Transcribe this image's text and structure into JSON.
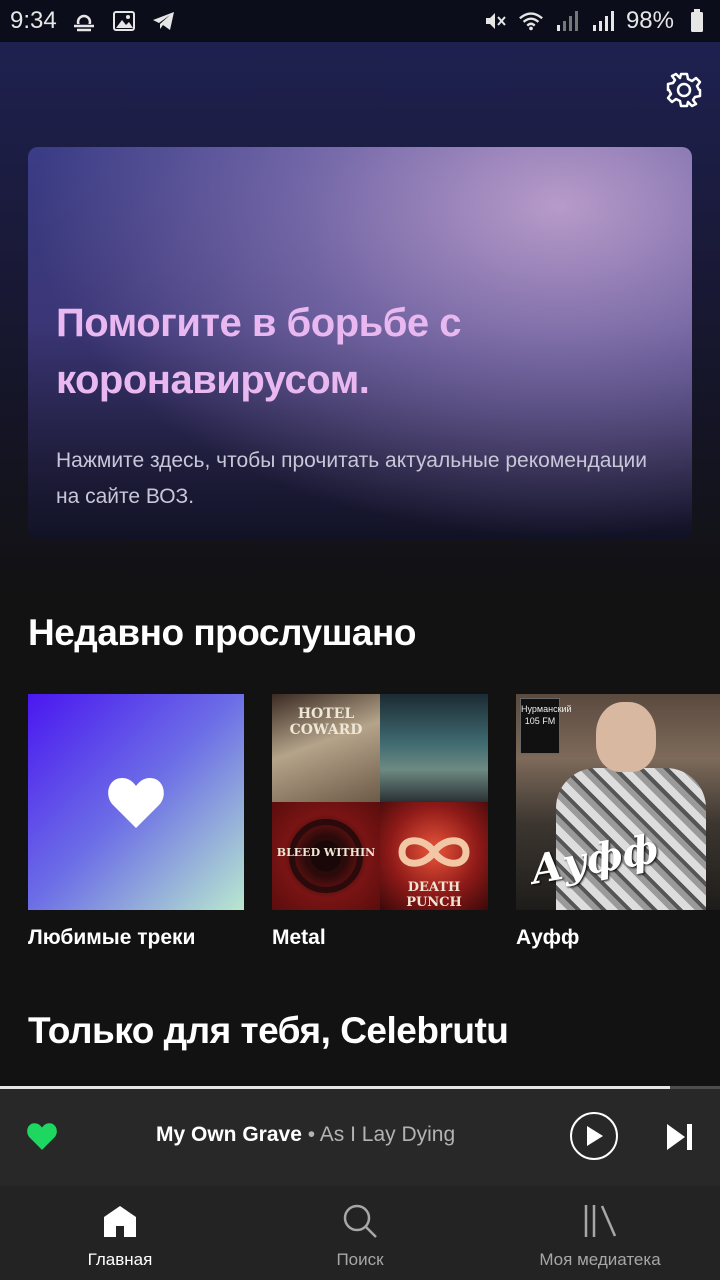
{
  "status_bar": {
    "time": "9:34",
    "battery": "98%",
    "left_icons": [
      "weather-icon",
      "gallery-icon",
      "telegram-icon"
    ],
    "right_icons": [
      "mute-icon",
      "wifi-icon",
      "signal-icon",
      "signal-icon",
      "battery-icon"
    ]
  },
  "header": {
    "settings_icon": "gear-icon"
  },
  "promo": {
    "title": "Помогите в борьбе с коронавирусом.",
    "subtitle": "Нажмите здесь, чтобы прочитать актуальные рекомендации на сайте ВОЗ."
  },
  "recent": {
    "title": "Недавно прослушано",
    "items": [
      {
        "label": "Любимые треки",
        "art": "heart-icon"
      },
      {
        "label": "Metal"
      },
      {
        "label": "Ауфф"
      }
    ]
  },
  "for_you": {
    "title": "Только для тебя, Celebrutu"
  },
  "artwork_text": {
    "metal_a": "HOTEL COWARD",
    "metal_c": "BLEED WITHIN",
    "metal_d": "DEATH PUNCH",
    "auff_badge": "Нурманский 105 FM",
    "auff_logo": "Ауфф"
  },
  "player": {
    "track": "My Own Grave",
    "separator": " • ",
    "artist": "As I Lay Dying",
    "progress": 0.93,
    "liked_color": "#1ed760"
  },
  "nav": {
    "items": [
      {
        "label": "Главная",
        "icon": "home-icon",
        "active": true
      },
      {
        "label": "Поиск",
        "icon": "search-icon",
        "active": false
      },
      {
        "label": "Моя медиатека",
        "icon": "library-icon",
        "active": false
      }
    ]
  },
  "colors": {
    "background": "#121212",
    "accent_green": "#1ed760",
    "promo_title": "#e9b8f0"
  }
}
